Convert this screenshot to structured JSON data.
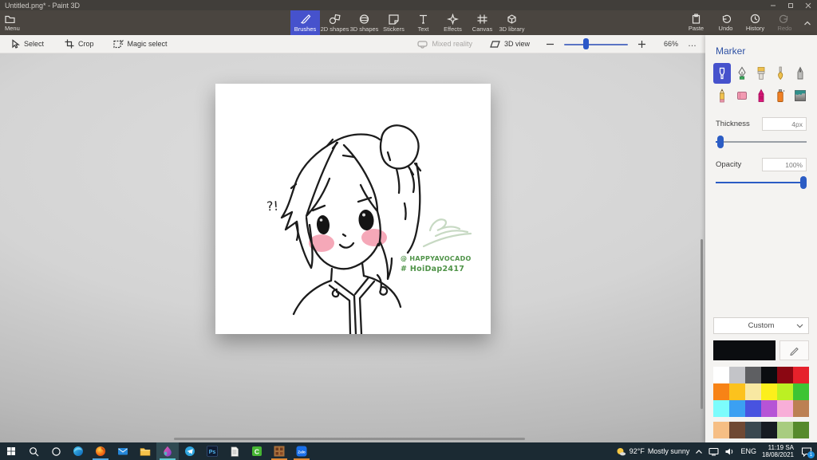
{
  "window": {
    "title": "Untitled.png* - Paint 3D"
  },
  "top_toolbar": {
    "menu": "Menu",
    "tabs": [
      {
        "label": "Brushes",
        "selected": true
      },
      {
        "label": "2D shapes"
      },
      {
        "label": "3D shapes"
      },
      {
        "label": "Stickers"
      },
      {
        "label": "Text"
      },
      {
        "label": "Effects"
      },
      {
        "label": "Canvas"
      },
      {
        "label": "3D library"
      }
    ],
    "actions": [
      {
        "label": "Paste"
      },
      {
        "label": "Undo"
      },
      {
        "label": "History"
      },
      {
        "label": "Redo",
        "disabled": true
      }
    ]
  },
  "edit_toolbar": {
    "select": "Select",
    "crop": "Crop",
    "magic_select": "Magic select",
    "mixed_reality": "Mixed reality",
    "view_3d": "3D view",
    "zoom_level": "66%",
    "more": "…"
  },
  "side_panel": {
    "title": "Marker",
    "brushes": [
      "marker",
      "calligraphy-pen",
      "oil-brush",
      "watercolour",
      "pixel-pen",
      "pencil",
      "eraser",
      "crayon",
      "spray-can",
      "fill"
    ],
    "selected_brush": "marker",
    "thickness": {
      "label": "Thickness",
      "value": "4px"
    },
    "opacity": {
      "label": "Opacity",
      "value": "100%"
    },
    "palette": {
      "dropdown_label": "Custom",
      "current_color": "#0b0d10",
      "colors": [
        "#ffffff",
        "#c3c4c8",
        "#5e5f62",
        "#0b0d10",
        "#8b0712",
        "#e6212b",
        "#f78316",
        "#fcc21d",
        "#f8e8a2",
        "#fcef1c",
        "#bcf023",
        "#3dc434",
        "#7cfcfc",
        "#3ba0f2",
        "#4853e0",
        "#b654d6",
        "#f8aed8",
        "#bc8053"
      ],
      "custom_colors": [
        "#f6be84",
        "#6f4934",
        "#3a4850",
        "#161b22",
        "#a8cc80",
        "#568a2c"
      ]
    },
    "accent_blue": "#4652cc"
  },
  "canvas": {
    "annotation": "?!",
    "credit_line1": "@ HAPPYAVOCADO",
    "credit_line2": "# HoiDap2417",
    "accent_green": "#4f9348",
    "signature_color": "#c7d9c3"
  },
  "taskbar": {
    "apps": [
      "start",
      "search",
      "cortana",
      "edge",
      "firefox",
      "mail",
      "file-explorer",
      "paint-3d",
      "telegram",
      "photoshop",
      "notepad",
      "camtasia",
      "tiles-app",
      "zalo"
    ],
    "photoshop_label": "Ps",
    "camtasia_label": "C",
    "zalo_label": "Zalo",
    "weather": {
      "temp": "92°F",
      "condition": "Mostly sunny"
    },
    "tray": {
      "language": "ENG",
      "time": "11:19 SA",
      "date": "18/08/2021",
      "notification_count": "1"
    }
  }
}
